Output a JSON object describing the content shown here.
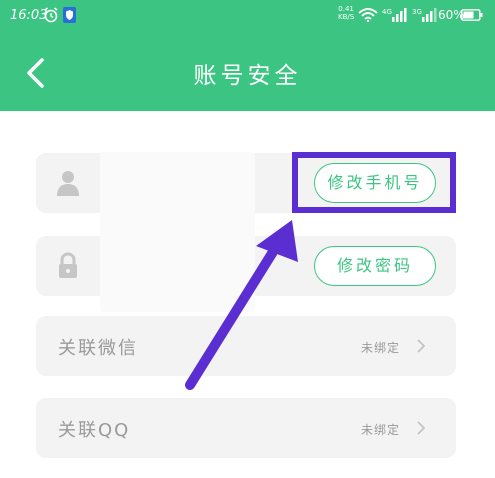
{
  "status_bar": {
    "time": "16:03",
    "speed_value": "0.41",
    "speed_unit": "KB/S",
    "net1": "4G",
    "net2": "3G",
    "battery": "60%"
  },
  "header": {
    "title": "账号安全"
  },
  "rows": {
    "phone": {
      "button_label": "修改手机号"
    },
    "password": {
      "button_label": "修改密码"
    },
    "wechat": {
      "label": "关联微信",
      "status": "未绑定"
    },
    "qq": {
      "label": "关联QQ",
      "status": "未绑定"
    }
  },
  "colors": {
    "primary": "#3cc582",
    "annotation": "#5a2ed0",
    "row_bg": "#f3f3f3",
    "muted_text": "#9a9a9a"
  },
  "icons": {
    "back": "chevron-left-icon",
    "user": "user-icon",
    "lock": "lock-icon",
    "chevron": "chevron-right-icon"
  }
}
